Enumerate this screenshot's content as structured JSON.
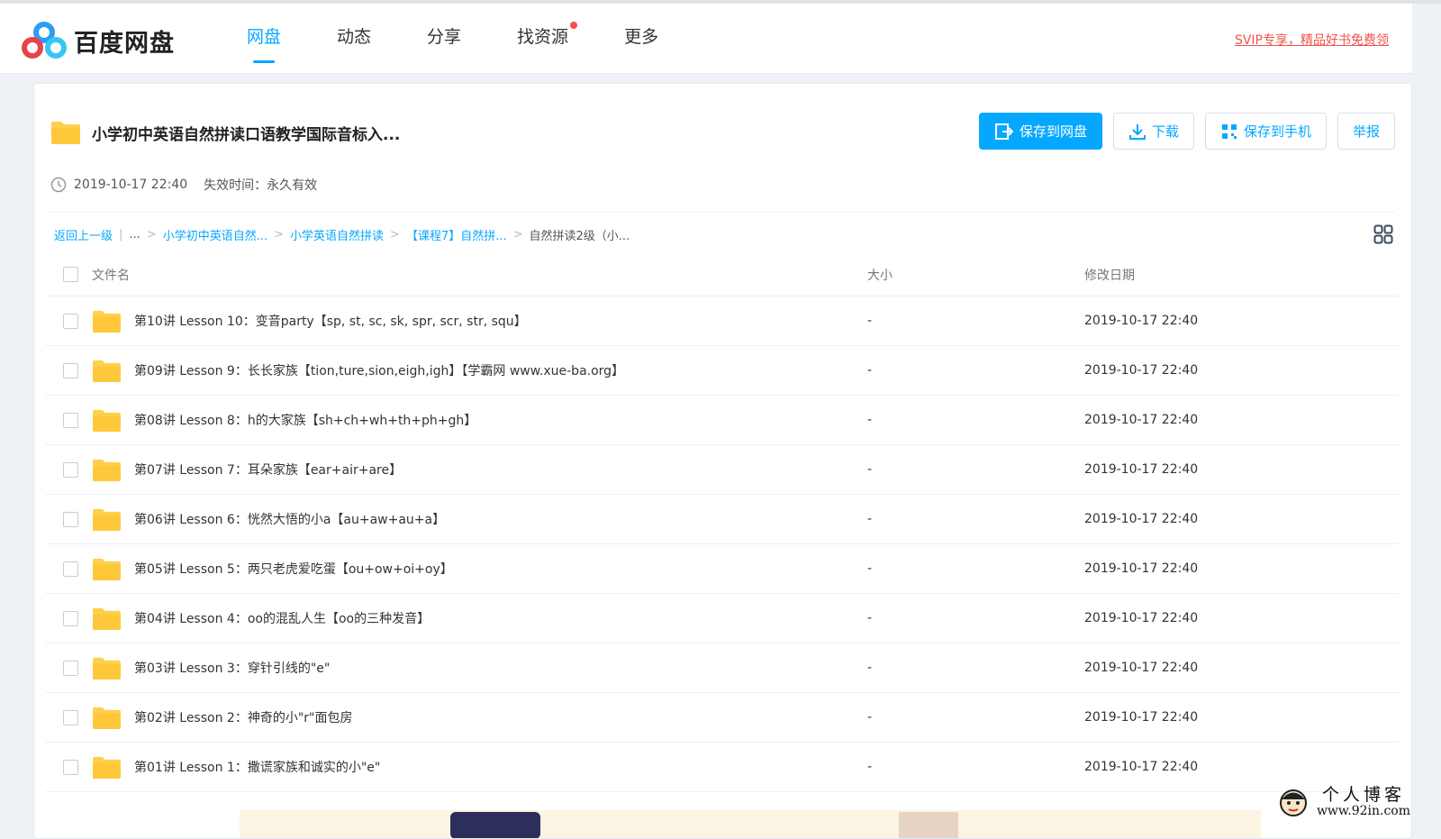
{
  "header": {
    "logo_text": "百度网盘",
    "nav": [
      {
        "label": "网盘",
        "active": true
      },
      {
        "label": "动态",
        "active": false
      },
      {
        "label": "分享",
        "active": false
      },
      {
        "label": "找资源",
        "active": false,
        "badge_dot": true
      },
      {
        "label": "更多",
        "active": false
      }
    ],
    "svip_link": "SVIP专享，精品好书免费领"
  },
  "share": {
    "title": "小学初中英语自然拼读口语教学国际音标入...",
    "date": "2019-10-17 22:40",
    "expire": "失效时间：永久有效",
    "actions": {
      "save_label": "保存到网盘",
      "download_label": "下载",
      "save_phone_label": "保存到手机",
      "report_label": "举报"
    }
  },
  "breadcrumb": {
    "back": "返回上一级",
    "ellipsis": "...",
    "items": [
      "小学初中英语自然...",
      "小学英语自然拼读",
      "【课程7】自然拼..."
    ],
    "current": "自然拼读2级（小..."
  },
  "table": {
    "headers": {
      "name": "文件名",
      "size": "大小",
      "date": "修改日期"
    },
    "rows": [
      {
        "name": "第10讲 Lesson 10：变音party【sp, st, sc, sk, spr, scr, str, squ】",
        "size": "-",
        "date": "2019-10-17 22:40"
      },
      {
        "name": "第09讲 Lesson 9：长长家族【tion,ture,sion,eigh,igh】【学霸网 www.xue-ba.org】",
        "size": "-",
        "date": "2019-10-17 22:40"
      },
      {
        "name": "第08讲 Lesson 8：h的大家族【sh+ch+wh+th+ph+gh】",
        "size": "-",
        "date": "2019-10-17 22:40"
      },
      {
        "name": "第07讲 Lesson 7：耳朵家族【ear+air+are】",
        "size": "-",
        "date": "2019-10-17 22:40"
      },
      {
        "name": "第06讲 Lesson 6：恍然大悟的小a【au+aw+au+a】",
        "size": "-",
        "date": "2019-10-17 22:40"
      },
      {
        "name": "第05讲 Lesson 5：两只老虎爱吃蛋【ou+ow+oi+oy】",
        "size": "-",
        "date": "2019-10-17 22:40"
      },
      {
        "name": "第04讲 Lesson 4：oo的混乱人生【oo的三种发音】",
        "size": "-",
        "date": "2019-10-17 22:40"
      },
      {
        "name": "第03讲 Lesson 3：穿针引线的\"e\"",
        "size": "-",
        "date": "2019-10-17 22:40"
      },
      {
        "name": "第02讲 Lesson 2：神奇的小\"r\"面包房",
        "size": "-",
        "date": "2019-10-17 22:40"
      },
      {
        "name": "第01讲 Lesson 1：撒谎家族和诚实的小\"e\"",
        "size": "-",
        "date": "2019-10-17 22:40"
      }
    ]
  },
  "watermark": {
    "title": "个人博客",
    "url": "www.92in.com"
  },
  "colors": {
    "accent": "#06a7ff",
    "folder": "#ffd04b",
    "alert": "#f2524c"
  },
  "icons": [
    "baidu-netdisk-logo-icon",
    "clock-icon",
    "save-to-disk-icon",
    "download-icon",
    "phone-qr-icon",
    "grid-view-icon",
    "folder-icon"
  ]
}
